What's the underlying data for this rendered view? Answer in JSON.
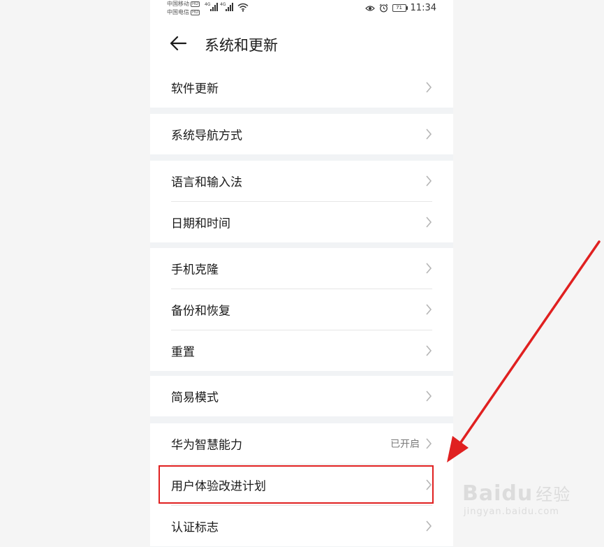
{
  "status_bar": {
    "carrier_1": "中国移动",
    "carrier_2": "中国电信",
    "hd_badge": "HD",
    "network_1": "4G",
    "network_2": "4G",
    "battery": "71",
    "time": "11:34",
    "icons": [
      "eye-comfort-icon",
      "alarm-icon",
      "wifi-icon",
      "signal-icon",
      "battery-icon"
    ]
  },
  "header": {
    "back_icon": "arrow-left-icon",
    "title": "系统和更新"
  },
  "groups": [
    [
      {
        "label": "软件更新"
      }
    ],
    [
      {
        "label": "系统导航方式"
      }
    ],
    [
      {
        "label": "语言和输入法"
      },
      {
        "label": "日期和时间"
      }
    ],
    [
      {
        "label": "手机克隆"
      },
      {
        "label": "备份和恢复"
      },
      {
        "label": "重置"
      }
    ],
    [
      {
        "label": "简易模式"
      }
    ],
    [
      {
        "label": "华为智慧能力",
        "value": "已开启"
      },
      {
        "label": "用户体验改进计划",
        "highlighted": true
      },
      {
        "label": "认证标志"
      }
    ]
  ],
  "annotation": {
    "highlight_color": "#e02020",
    "arrow_color": "#e02020"
  },
  "watermark": {
    "brand": "Baidu",
    "brand_suffix": "经验",
    "url": "jingyan.baidu.com"
  }
}
